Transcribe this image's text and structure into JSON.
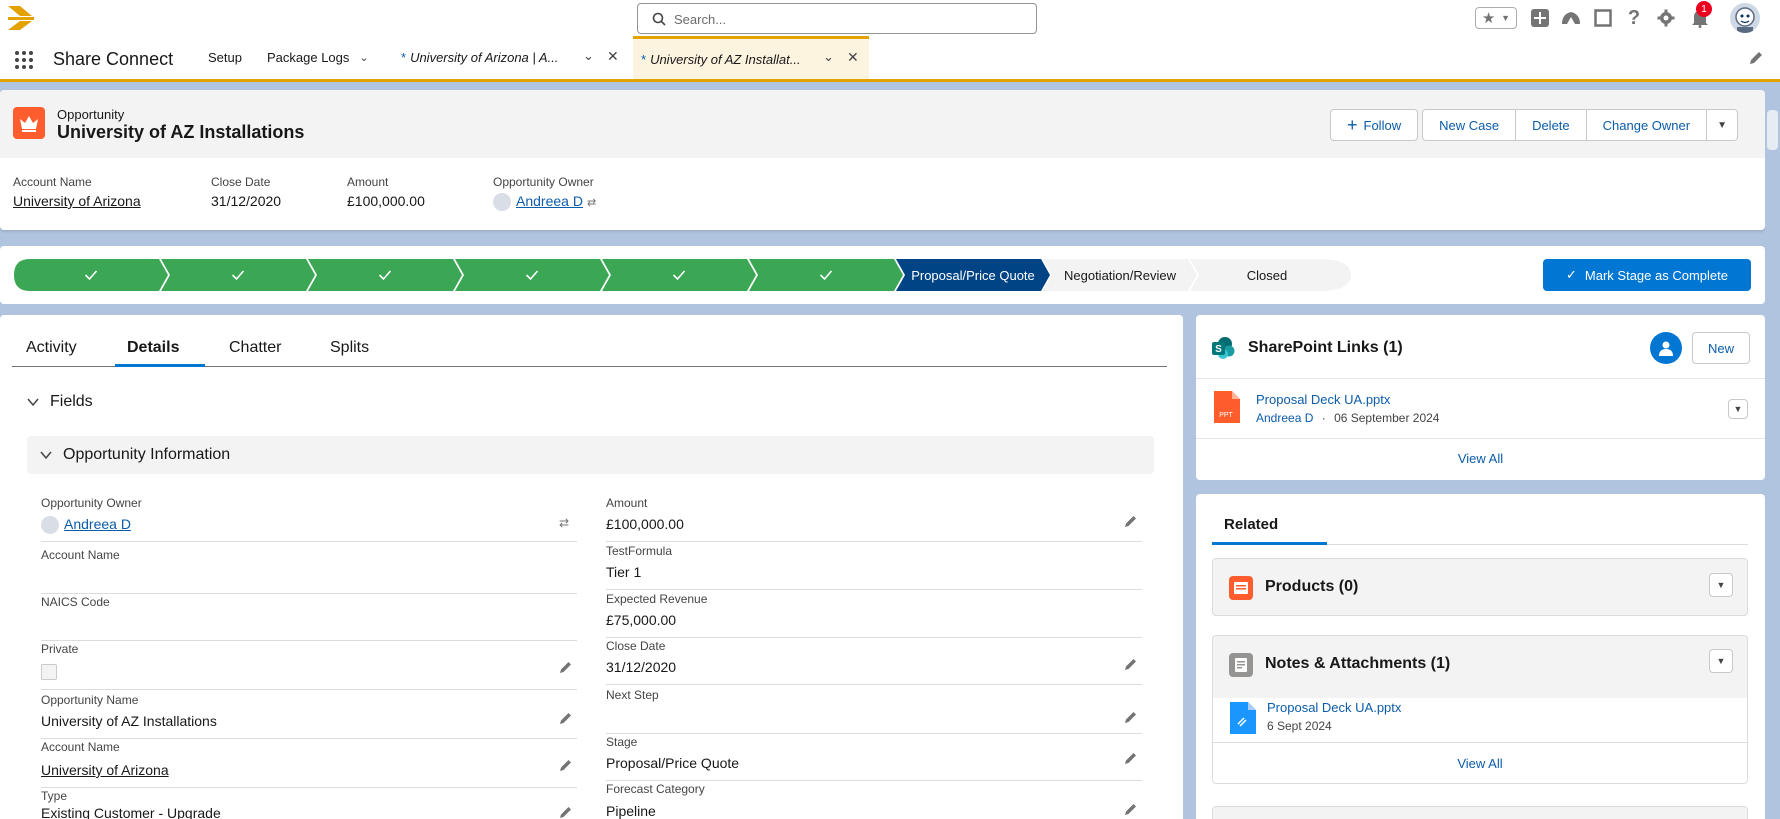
{
  "search": {
    "placeholder": "Search..."
  },
  "notifications": {
    "count": "1"
  },
  "nav": {
    "app_name": "Share Connect",
    "items": [
      {
        "label": "Setup"
      },
      {
        "label": "Package Logs"
      }
    ],
    "tabs": [
      {
        "modified": "*",
        "label": "University of Arizona | A..."
      },
      {
        "modified": "*",
        "label": "University of AZ Installat..."
      }
    ]
  },
  "record": {
    "type": "Opportunity",
    "title": "University of AZ Installations",
    "actions": {
      "follow": "Follow",
      "new_case": "New Case",
      "delete": "Delete",
      "change_owner": "Change Owner"
    },
    "highlights": [
      {
        "label": "Account Name",
        "value": "University of Arizona"
      },
      {
        "label": "Close Date",
        "value": "31/12/2020"
      },
      {
        "label": "Amount",
        "value": "£100,000.00"
      },
      {
        "label": "Opportunity Owner",
        "value": "Andreea D"
      }
    ]
  },
  "path": {
    "stages": [
      {
        "label": "Proposal/Price Quote",
        "status": "current"
      },
      {
        "label": "Negotiation/Review",
        "status": "todo"
      },
      {
        "label": "Closed",
        "status": "todo"
      }
    ],
    "completed_count": 6,
    "mark_complete": "Mark Stage as Complete"
  },
  "tabs": {
    "activity": "Activity",
    "details": "Details",
    "chatter": "Chatter",
    "splits": "Splits"
  },
  "fields_section": {
    "toggle": "Fields",
    "section_title": "Opportunity Information",
    "left": [
      {
        "label": "Opportunity Owner",
        "value": "Andreea D"
      },
      {
        "label": "Account Name",
        "value": ""
      },
      {
        "label": "NAICS Code",
        "value": ""
      },
      {
        "label": "Private",
        "value": ""
      },
      {
        "label": "Opportunity Name",
        "value": "University of AZ Installations"
      },
      {
        "label": "Account Name",
        "value": "University of Arizona"
      },
      {
        "label": "Type",
        "value": "Existing Customer - Upgrade"
      }
    ],
    "right": [
      {
        "label": "Amount",
        "value": "£100,000.00"
      },
      {
        "label": "TestFormula",
        "value": "Tier 1"
      },
      {
        "label": "Expected Revenue",
        "value": "£75,000.00"
      },
      {
        "label": "Close Date",
        "value": "31/12/2020"
      },
      {
        "label": "Next Step",
        "value": ""
      },
      {
        "label": "Stage",
        "value": "Proposal/Price Quote"
      },
      {
        "label": "Forecast Category",
        "value": "Pipeline"
      }
    ]
  },
  "sharepoint": {
    "title": "SharePoint Links (1)",
    "new_label": "New",
    "file": {
      "name": "Proposal Deck UA.pptx",
      "owner": "Andreea D",
      "separator": "·",
      "date": "06 September 2024"
    },
    "view_all": "View All"
  },
  "related": {
    "tab": "Related",
    "products": "Products (0)",
    "notes": "Notes & Attachments (1)",
    "notes_file": {
      "name": "Proposal Deck UA.pptx",
      "date": "6 Sept 2024"
    },
    "view_all": "View All"
  },
  "colors": {
    "brand": "#0176d3",
    "complete": "#3ba755",
    "current": "#014486",
    "accent_tab": "#e4a201",
    "opportunity": "#ff5d2d"
  }
}
